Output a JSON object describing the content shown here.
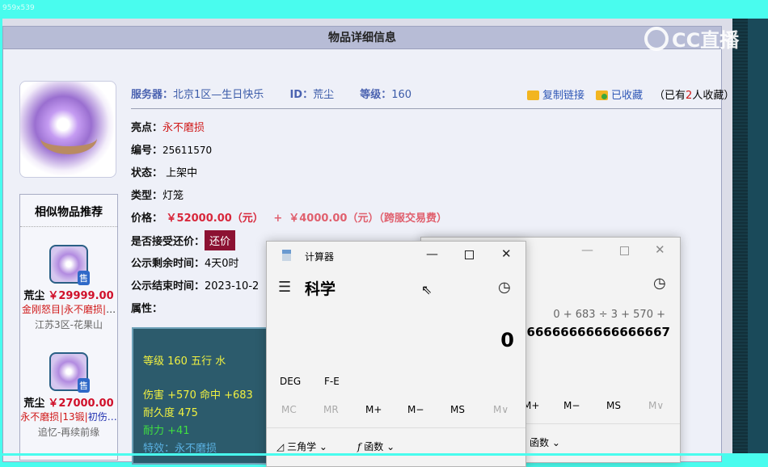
{
  "screen_label": "959x539",
  "watermark": "CC直播",
  "header": {
    "title": "物品详细信息"
  },
  "item": {
    "server_label": "服务器：",
    "server": "北京1区—生日快乐",
    "id_label": "ID：",
    "id": "荒尘",
    "level_label": "等级：",
    "level": "160",
    "copy_link": "复制链接",
    "favorited": "已收藏",
    "fav_prefix": "（已有",
    "fav_count": "2",
    "fav_suffix": "人收藏）",
    "highlight_label": "亮点：",
    "highlight": "永不磨损",
    "number_label": "编号：",
    "number": "25611570",
    "status_label": "状态：",
    "status": "上架中",
    "type_label": "类型：",
    "type": "灯笼",
    "price_label": "价格：",
    "price": "￥52000.00（元）",
    "plus": "+",
    "fee": "￥4000.00（元）（跨服交易费）",
    "bargain_label": "是否接受还价：",
    "bargain_button": "还价",
    "remain_label": "公示剩余时间：",
    "remain": "4天0时",
    "end_label": "公示结束时间：",
    "end": "2023-10-2",
    "attr_label": "属性："
  },
  "attributes": [
    {
      "text": "等级 160 五行 水",
      "color": "#f0f040"
    },
    {
      "text": "伤害 +570 命中 +683",
      "color": "#f0f040"
    },
    {
      "text": "耐久度 475",
      "color": "#f0f040"
    },
    {
      "text": "耐力 +41",
      "color": "#40e040"
    },
    {
      "text": "特效：永不磨损",
      "color": "#5ab0e0"
    }
  ],
  "recommend": {
    "title": "相似物品推荐",
    "items": [
      {
        "badge": "售",
        "name": "荒尘",
        "price": "￥29999.00",
        "tags": [
          "金刚怒目",
          "永不磨损",
          "…"
        ],
        "server": "江苏3区-花果山"
      },
      {
        "badge": "售",
        "name": "荒尘",
        "price": "￥27000.00",
        "tags": [
          "永不磨损",
          "13锻",
          "初伤…"
        ],
        "server": "追忆-再续前缘"
      }
    ]
  },
  "calc_front": {
    "title": "计算器",
    "mode": "科学",
    "display": "0",
    "deg": "DEG",
    "fe": "F-E",
    "mem": [
      "MC",
      "MR",
      "M+",
      "M−",
      "MS",
      "M∨"
    ],
    "trig": "三角学",
    "func": "函数"
  },
  "calc_back": {
    "expression": "0 + 683 ÷ 3 + 570 +",
    "display": "6666666666666666667",
    "mem": [
      "M+",
      "M−",
      "MS",
      "M∨"
    ],
    "func": "函数"
  }
}
